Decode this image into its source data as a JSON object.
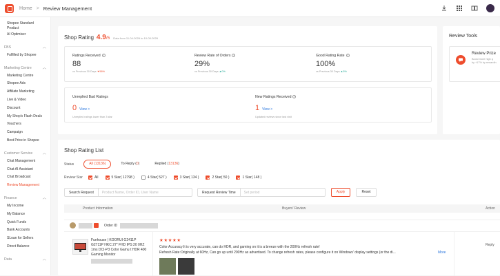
{
  "header": {
    "home": "Home",
    "separator": ">",
    "current": "Review Management"
  },
  "sidebar": {
    "top_items": [
      "Shopee Standard",
      "Product",
      "AI Optimiser"
    ],
    "sections": [
      {
        "title": "FBS",
        "items": [
          "Fulfilled by Shopee"
        ]
      },
      {
        "title": "Marketing Centre",
        "items": [
          "Marketing Centre",
          "Shopee Ads",
          "Affiliate Marketing",
          "Live & Video",
          "Discount",
          "My Shop's Flash Deals",
          "Vouchers",
          "Campaign",
          "Best Price in Shopee"
        ]
      },
      {
        "title": "Customer Service",
        "items": [
          "Chat Management",
          "Chat AI Assistant",
          "Chat Broadcast",
          "Review Management"
        ]
      },
      {
        "title": "Finance",
        "items": [
          "My Income",
          "My Balance",
          "Quick Funds",
          "Bank Accounts",
          "SLoan for Sellers",
          "Direct Balance"
        ]
      },
      {
        "title": "Data",
        "items": []
      }
    ],
    "active": "Review Management"
  },
  "shop_rating": {
    "title": "Shop Rating",
    "score": "4.9",
    "denominator": "/5",
    "data_from": "Data from 11-04-2026 to 10-05-2026",
    "metrics": [
      {
        "label": "Ratings Received",
        "value": "88",
        "compare": "vs Previous 30 Days",
        "change": "▼56%",
        "dir": "down"
      },
      {
        "label": "Review Rate of Orders",
        "value": "29%",
        "compare": "vs Previous 30 Days",
        "change": "▲0%",
        "dir": "up"
      },
      {
        "label": "Good Rating Rate",
        "value": "100%",
        "compare": "vs Previous 30 Days",
        "change": "▲5%",
        "dir": "up"
      }
    ],
    "unreplied": {
      "label": "Unreplied Bad Ratings",
      "value": "0",
      "view": "View >",
      "sub": "Unreplied ratings lower than 3 star"
    },
    "new_ratings": {
      "label": "New Ratings Received",
      "value": "1",
      "view": "View >",
      "sub": "Updated reviews since last visit"
    }
  },
  "review_tools": {
    "title": "Review Tools",
    "prize_title": "Review Prize",
    "prize_desc_1": "Boost more high q",
    "prize_desc_2": "by +17% by rewardin",
    "accent": "#ee4d2d"
  },
  "rating_list": {
    "title": "Shop Rating List",
    "status_label": "Status",
    "status_tabs": [
      "All (13136)",
      "To Reply (0)",
      "Replied (13136)"
    ],
    "review_star_label": "Review Star",
    "star_options": [
      {
        "label": "All",
        "checked": true
      },
      {
        "label": "5 Star( 12798 )",
        "checked": true
      },
      {
        "label": "4 Star( 527 )",
        "checked": false
      },
      {
        "label": "3 Star( 134 )",
        "checked": true
      },
      {
        "label": "2 Star( 50 )",
        "checked": true
      },
      {
        "label": "1 Star( 148 )",
        "checked": true
      }
    ],
    "search_label": "Search Request",
    "search_placeholder": "Product Name, Order ID, User Name",
    "time_label": "Request Review Time",
    "time_placeholder": "Set period",
    "apply": "Apply",
    "reset": "Reset",
    "columns": [
      "Product Information",
      "Buyers' Review",
      "Action"
    ],
    "row": {
      "order_label": "Order ID",
      "product_name": "Funhouse | KOORUI G2411P G2711P HKC 27\" FHD IPS 20 0HZ 1ms DCI-P3 Color Gamu t HDR 400 Gaming Monitor",
      "stars": "★★★★★",
      "review_line1": "Color Accuracy:It is very accurate, can do HDR, and gaming on it is a breeze with the 200Hz refresh rate!",
      "review_line2": "Refresh Rate:Originally at 60Hz, Can go up until 200Hz as advertised. To change refresh rates, please configure it on Windows' display settings (or the di...",
      "more": "More",
      "reply": "Reply"
    }
  }
}
